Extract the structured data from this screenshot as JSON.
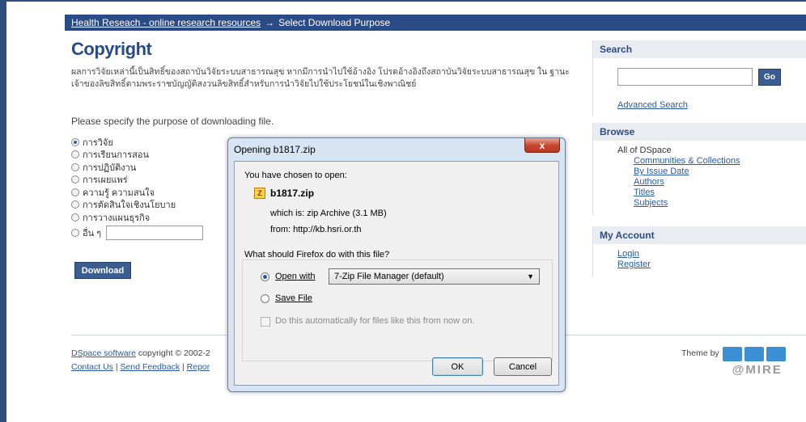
{
  "breadcrumb": {
    "link": "Health Reseach - online research resources",
    "arrow": "→",
    "current": "Select Download Purpose"
  },
  "main": {
    "title": "Copyright",
    "copyright_text": "ผลการวิจัยเหล่านี้เป็นสิทธิ์ของสถาบันวิจัยระบบสาธารณสุข หากมีการนำไปใช้อ้างอิง โปรดอ้างอิงถึงสถาบันวิจัยระบบสาธารณสุข ใน ฐานะเจ้าของลิขสิทธิ์ตามพระราชบัญญัติสงวนลิขสิทธิ์สำหรับการนำวิจัยไปใช้ประโยชน์ในเชิงพาณิชย์",
    "purpose_prompt": "Please specify the purpose of downloading file.",
    "purposes": [
      {
        "label": "การวิจัย",
        "checked": true
      },
      {
        "label": "การเรียนการสอน",
        "checked": false
      },
      {
        "label": "การปฏิบัติงาน",
        "checked": false
      },
      {
        "label": "การเผยแพร่",
        "checked": false
      },
      {
        "label": "ความรู้ ความสนใจ",
        "checked": false
      },
      {
        "label": "การตัดสินใจเชิงนโยบาย",
        "checked": false
      },
      {
        "label": "การวางแผนธุรกิจ",
        "checked": false
      },
      {
        "label": "อื่น ๆ",
        "checked": false
      }
    ],
    "download_label": "Download"
  },
  "footer": {
    "dspace_link": "DSpace software",
    "copyright": "copyright © 2002-2",
    "contact": "Contact Us",
    "sep": "|",
    "feedback": "Send Feedback",
    "report": "Repor",
    "theme_by": "Theme by",
    "logo_text": "@MIRE"
  },
  "sidebar": {
    "search_title": "Search",
    "go_label": "Go",
    "advanced_search": "Advanced Search",
    "browse_title": "Browse",
    "all_of": "All of DSpace",
    "browse_links": [
      "Communities & Collections",
      "By Issue Date",
      "Authors",
      "Titles",
      "Subjects"
    ],
    "account_title": "My Account",
    "login": "Login",
    "register": "Register"
  },
  "dialog": {
    "title": "Opening b1817.zip",
    "close": "x",
    "chosen": "You have chosen to open:",
    "filename": "b1817.zip",
    "which_is": "which is:  zip Archive (3.1 MB)",
    "from": "from:  http://kb.hsri.or.th",
    "question": "What should Firefox do with this file?",
    "open_with": "Open with",
    "open_app": "7-Zip File Manager (default)",
    "save_file": "Save File",
    "auto": "Do this automatically for files like this from now on.",
    "ok": "OK",
    "cancel": "Cancel"
  }
}
